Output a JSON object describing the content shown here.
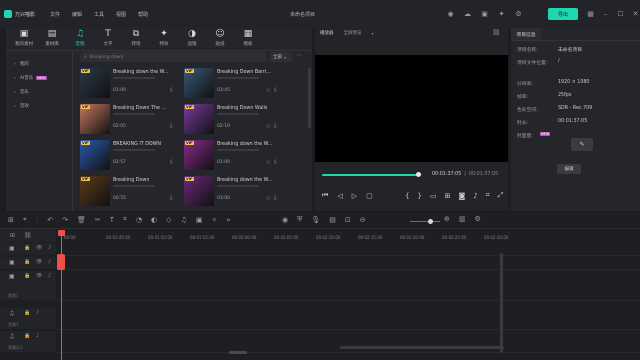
{
  "app": {
    "name": "万兴喵影",
    "menus": [
      "文件",
      "编辑",
      "工具",
      "视图",
      "帮助"
    ],
    "project_title": "未命名项目",
    "export_label": "导出"
  },
  "media": {
    "tabs": [
      {
        "label": "我的素材",
        "icon": "folder-icon"
      },
      {
        "label": "素材库",
        "icon": "library-icon"
      },
      {
        "label": "音频",
        "icon": "music-note-icon"
      },
      {
        "label": "文字",
        "icon": "text-icon"
      },
      {
        "label": "转场",
        "icon": "transition-icon"
      },
      {
        "label": "特效",
        "icon": "effects-icon"
      },
      {
        "label": "滤镜",
        "icon": "filter-icon"
      },
      {
        "label": "贴纸",
        "icon": "sticker-icon"
      },
      {
        "label": "模板",
        "icon": "template-icon"
      }
    ],
    "active_tab": 2,
    "sidebar": [
      {
        "label": "我的"
      },
      {
        "label": "AI音乐",
        "badge": "NEW"
      },
      {
        "label": "音乐"
      },
      {
        "label": "音效"
      }
    ],
    "search_placeholder": "Breaking down",
    "filter_label": "全部",
    "cards": [
      {
        "title": "Breaking down the W...",
        "duration": "01:00",
        "vip": true,
        "thumb": "#2a3a4a"
      },
      {
        "title": "Breaking Down Barri...",
        "duration": "03:45",
        "vip": true,
        "thumb": "#3a5878"
      },
      {
        "title": "Breaking Down The ...",
        "duration": "02:05",
        "vip": true,
        "thumb": "#c87860"
      },
      {
        "title": "Breaking Down Walls",
        "duration": "02:19",
        "vip": true,
        "thumb": "#7a3aa0"
      },
      {
        "title": "BREAKING IT DOWN",
        "duration": "02:57",
        "vip": true,
        "thumb": "#2a5ab0"
      },
      {
        "title": "Breaking down the W...",
        "duration": "01:00",
        "vip": true,
        "thumb": "#8a2a8a"
      },
      {
        "title": "Breaking Down",
        "duration": "00:55",
        "vip": true,
        "thumb": "#5a3a1a"
      },
      {
        "title": "Breaking down the W...",
        "duration": "03:00",
        "vip": true,
        "thumb": "#6a2a7a"
      }
    ]
  },
  "player": {
    "tab1": "播放器",
    "tab2": "全屏预览",
    "current_time": "00:01:37:05",
    "total_time": "00:01:37:05",
    "progress": 0.98
  },
  "properties": {
    "header": "项目信息",
    "rows": [
      {
        "label": "项目名称:",
        "value": "未命名项目"
      },
      {
        "label": "项目文件位置:",
        "value": "/"
      },
      {
        "label": "分辨率:",
        "value": "1920 × 1080"
      },
      {
        "label": "帧率:",
        "value": "25fps"
      },
      {
        "label": "色彩空间:",
        "value": "SDR - Rec.709"
      },
      {
        "label": "时长:",
        "value": "00:01:37:05"
      },
      {
        "label": "封面图:",
        "value": ""
      }
    ],
    "cover_badge": "NEW",
    "edit_label": "编辑"
  },
  "timeline": {
    "ticks": [
      "00:00",
      "00:01:45:00",
      "00:01:50:00",
      "00:01:55:00",
      "00:02:00:00",
      "00:02:05:00",
      "00:02:10:00",
      "00:02:15:00",
      "00:02:20:00",
      "00:02:25:00",
      "00:02:30:00"
    ],
    "tracks": [
      {
        "label": "",
        "type": "video"
      },
      {
        "label": "",
        "type": "video"
      },
      {
        "label": "视频1",
        "type": "video"
      },
      {
        "label": "音频1",
        "type": "audio"
      },
      {
        "label": "背景乐1",
        "type": "audio"
      }
    ]
  },
  "colors": {
    "accent": "#1fd6b0",
    "playhead": "#f0504a",
    "vip": "#f2c94c"
  }
}
